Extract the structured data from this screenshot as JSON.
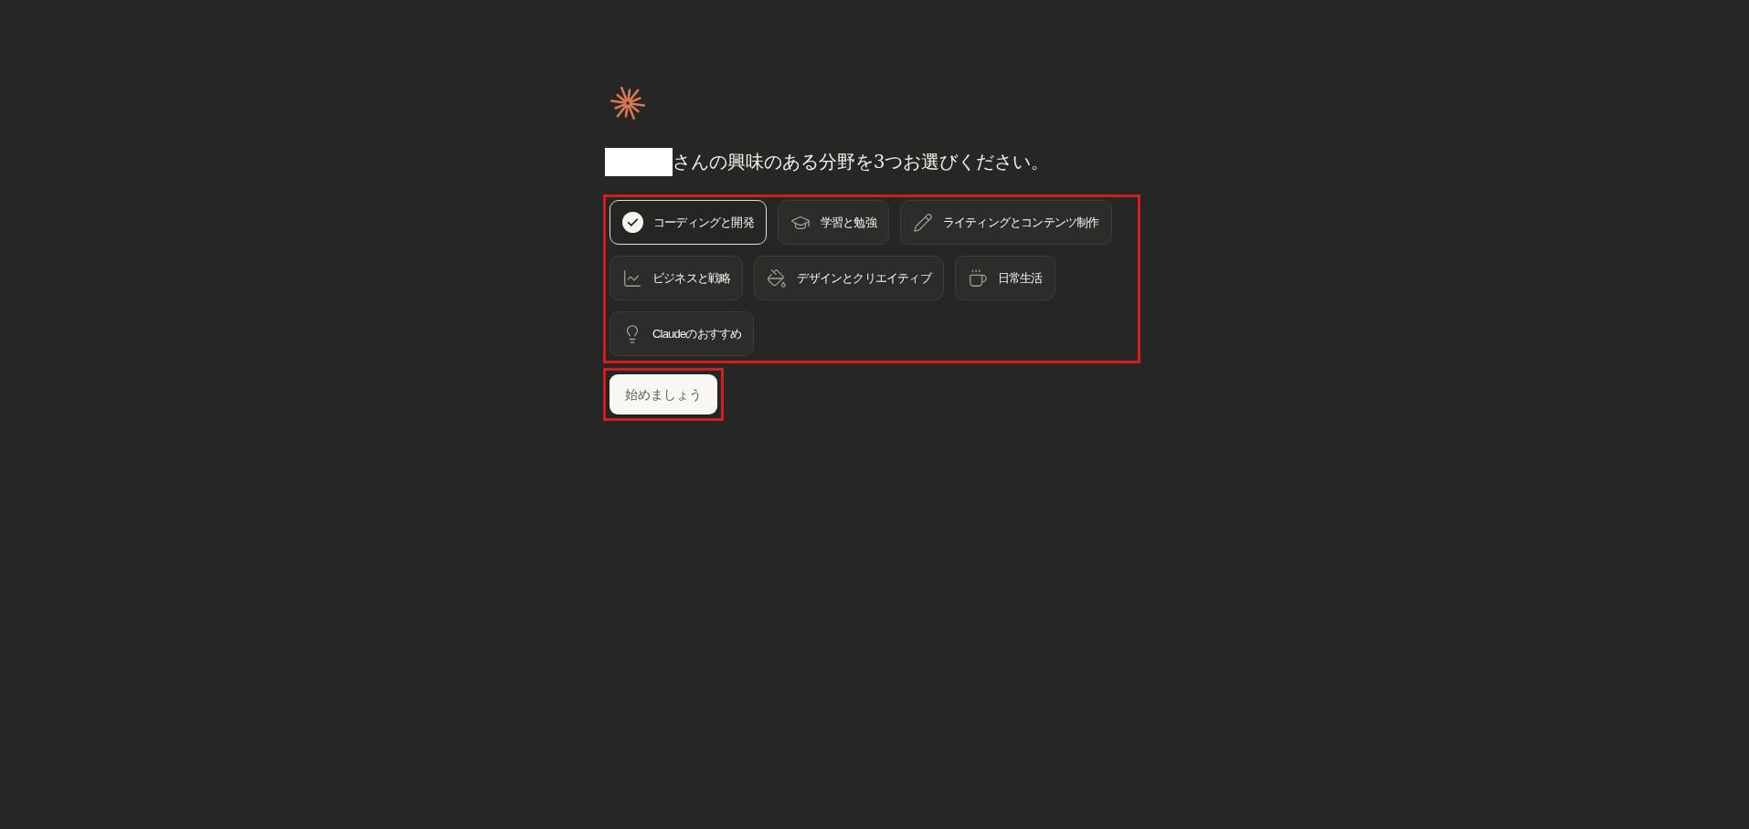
{
  "heading": {
    "text": "さんの興味のある分野を3つお選びください。"
  },
  "interests": [
    {
      "label": "コーディングと開発",
      "selected": true
    },
    {
      "label": "学習と勉強",
      "selected": false
    },
    {
      "label": "ライティングとコンテンツ制作",
      "selected": false
    },
    {
      "label": "ビジネスと戦略",
      "selected": false
    },
    {
      "label": "デザインとクリエイティブ",
      "selected": false
    },
    {
      "label": "日常生活",
      "selected": false
    },
    {
      "label": "Claudeのおすすめ",
      "selected": false
    }
  ],
  "start_button": {
    "label": "始めましょう"
  }
}
